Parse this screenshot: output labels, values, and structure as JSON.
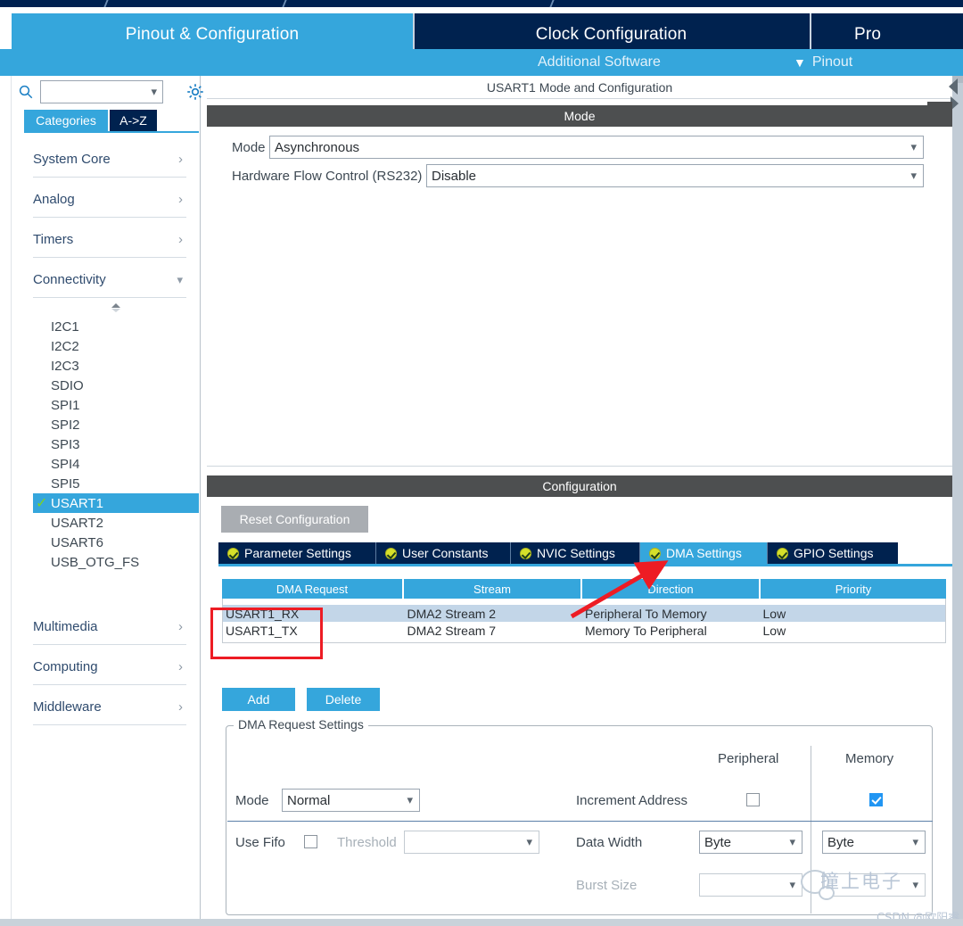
{
  "app": {
    "tabs": [
      {
        "label": "Pinout & Configuration",
        "active": true
      },
      {
        "label": "Clock Configuration",
        "active": false
      },
      {
        "label": "Pro",
        "active": false
      }
    ],
    "subbar": {
      "additional_software": "Additional Software",
      "pinout": "Pinout",
      "pinout_chevron": "chevron-down-icon"
    },
    "accent_blue": "#35a6dc",
    "navy": "#00224f"
  },
  "sidebar": {
    "search": {
      "value": "",
      "placeholder": ""
    },
    "search_icon": "search-icon",
    "gear_icon": "gear-icon",
    "segments": [
      {
        "label": "Categories",
        "active": true
      },
      {
        "label": "A->Z",
        "active": false
      }
    ],
    "categories": [
      {
        "label": "System Core",
        "state": "collapsed",
        "chevron": "chevron-right-icon"
      },
      {
        "label": "Analog",
        "state": "collapsed",
        "chevron": "chevron-right-icon"
      },
      {
        "label": "Timers",
        "state": "collapsed",
        "chevron": "chevron-right-icon"
      },
      {
        "label": "Connectivity",
        "state": "expanded",
        "chevron": "chevron-down-icon"
      }
    ],
    "peripherals": [
      {
        "label": "I2C1",
        "selected": false
      },
      {
        "label": "I2C2",
        "selected": false
      },
      {
        "label": "I2C3",
        "selected": false
      },
      {
        "label": "SDIO",
        "selected": false
      },
      {
        "label": "SPI1",
        "selected": false
      },
      {
        "label": "SPI2",
        "selected": false
      },
      {
        "label": "SPI3",
        "selected": false
      },
      {
        "label": "SPI4",
        "selected": false
      },
      {
        "label": "SPI5",
        "selected": false
      },
      {
        "label": "USART1",
        "selected": true,
        "check": "✓"
      },
      {
        "label": "USART2",
        "selected": false
      },
      {
        "label": "USART6",
        "selected": false
      },
      {
        "label": "USB_OTG_FS",
        "selected": false
      }
    ],
    "categories_bottom": [
      {
        "label": "Multimedia",
        "state": "collapsed",
        "chevron": "chevron-right-icon"
      },
      {
        "label": "Computing",
        "state": "collapsed",
        "chevron": "chevron-right-icon"
      },
      {
        "label": "Middleware",
        "state": "collapsed",
        "chevron": "chevron-right-icon"
      }
    ]
  },
  "main": {
    "panel_title": "USART1 Mode and Configuration",
    "mode_band": "Mode",
    "mode_fields": [
      {
        "label": "Mode",
        "value": "Asynchronous"
      },
      {
        "label": "Hardware Flow Control (RS232)",
        "value": "Disable"
      }
    ],
    "config_band": "Configuration",
    "reset_button": "Reset Configuration",
    "config_tabs": [
      {
        "label": "Parameter Settings",
        "active": false,
        "status": "ok"
      },
      {
        "label": "User Constants",
        "active": false,
        "status": "ok"
      },
      {
        "label": "NVIC Settings",
        "active": false,
        "status": "ok"
      },
      {
        "label": "DMA Settings",
        "active": true,
        "status": "ok"
      },
      {
        "label": "GPIO Settings",
        "active": false,
        "status": "ok"
      }
    ],
    "dma_table": {
      "columns": [
        "DMA Request",
        "Stream",
        "Direction",
        "Priority"
      ],
      "rows": [
        {
          "selected": true,
          "cells": [
            "USART1_RX",
            "DMA2 Stream 2",
            "Peripheral To Memory",
            "Low"
          ]
        },
        {
          "selected": false,
          "cells": [
            "USART1_TX",
            "DMA2 Stream 7",
            "Memory To Peripheral",
            "Low"
          ]
        }
      ]
    },
    "add_button": "Add",
    "delete_button": "Delete",
    "request_settings": {
      "legend": "DMA Request Settings",
      "col_peripheral": "Peripheral",
      "col_memory": "Memory",
      "mode_label": "Mode",
      "mode_value": "Normal",
      "increment_address_label": "Increment Address",
      "increment_peripheral_checked": false,
      "increment_memory_checked": true,
      "use_fifo_label": "Use Fifo",
      "use_fifo_checked": false,
      "threshold_label": "Threshold",
      "threshold_value": "",
      "data_width_label": "Data Width",
      "data_width_peripheral": "Byte",
      "data_width_memory": "Byte",
      "burst_size_label": "Burst Size",
      "burst_size_peripheral": "",
      "burst_size_memory": ""
    }
  },
  "annotations": {
    "red_box_target": "DMA Request column cells",
    "red_arrow_target": "DMA Settings tab",
    "red_color": "#ed1c24"
  },
  "watermark": {
    "brand": "撞上电子",
    "credit": "CSDN @欧阳睿"
  }
}
